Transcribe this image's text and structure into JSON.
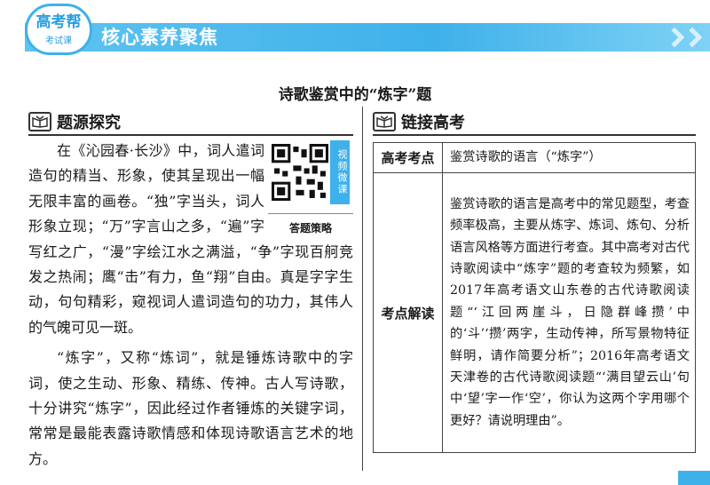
{
  "header": {
    "badge_main": "高考帮",
    "badge_sub": "考试课",
    "title": "核心素养聚焦"
  },
  "page_title": "诗歌鉴赏中的“炼字”题",
  "left_section": {
    "heading": "题源探究",
    "icon": "section-book-icon",
    "paragraph1": "在《沁园春·长沙》中，词人遣词造句的精当、形象，使其呈现出一幅无限丰富的画卷。“独”字当头，词人形象立现；“万”字言山之多，“遍”字写红之广，“漫”字绘江水之满溢，“争”字现百舸竞发之热闹；鹰“击”有力，鱼“翔”自由。真是字字生动，句句精彩，窥视词人遣词造句的功力，其伟人的气魄可见一斑。",
    "paragraph2": "“炼字”，又称“炼词”，就是锤炼诗歌中的字词，使之生动、形象、精练、传神。古人写诗歌，十分讲究“炼字”，因此经过作者锤炼的关键字词，常常是最能表露诗歌情感和体现诗歌语言艺术的地方。",
    "qr": {
      "tag": "视频微课",
      "caption": "答题策略"
    }
  },
  "right_section": {
    "heading": "链接高考",
    "icon": "section-book-icon",
    "table": {
      "row1_label": "高考考点",
      "row1_value": "鉴赏诗歌的语言（“炼字”）",
      "row2_label": "考点解读",
      "row2_value": "鉴赏诗歌的语言是高考中的常见题型，考查频率极高，主要从炼字、炼词、炼句、分析语言风格等方面进行考查。其中高考对古代诗歌阅读中“炼字”题的考查较为频繁，如2017年高考语文山东卷的古代诗歌阅读题“‘江回两崖斗，日隐群峰攒’中的‘斗’‘攒’两字，生动传神，所写景物特征鲜明，请作简要分析”；2016年高考语文天津卷的古代诗歌阅读题“‘满目望云山’句中‘望’字一作‘空’，你认为这两个字用哪个更好？请说明理由”。"
    }
  },
  "colors": {
    "accent": "#3fb1ea",
    "text": "#1a1a1a"
  }
}
